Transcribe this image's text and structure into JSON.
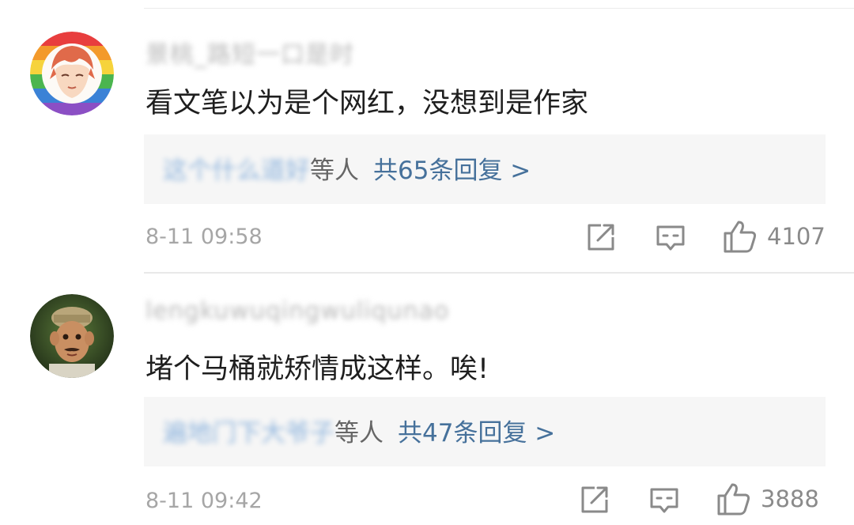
{
  "comments": [
    {
      "username": "景桃_路短一口是时",
      "text": "看文笔以为是个网红，没想到是作家",
      "reply_names": "这个什么道好",
      "reply_suffix": "等人",
      "reply_count": "共65条回复 >",
      "timestamp": "8-11 09:58",
      "likes": "4107"
    },
    {
      "username": "lengkuwuqingwuliqunao",
      "text": "堵个马桶就矫情成这样。唉!",
      "reply_names": "遍地门下大爷子",
      "reply_suffix": "等人",
      "reply_count": "共47条回复 >",
      "timestamp": "8-11 09:42",
      "likes": "3888"
    }
  ],
  "icons": {
    "share": "share-icon",
    "comment": "comment-icon",
    "like": "thumbs-up-icon"
  },
  "colors": {
    "link_blue": "#46719b",
    "text": "#1e1e1e",
    "muted": "#a6a6a6",
    "reply_bg": "#f6f6f6"
  }
}
